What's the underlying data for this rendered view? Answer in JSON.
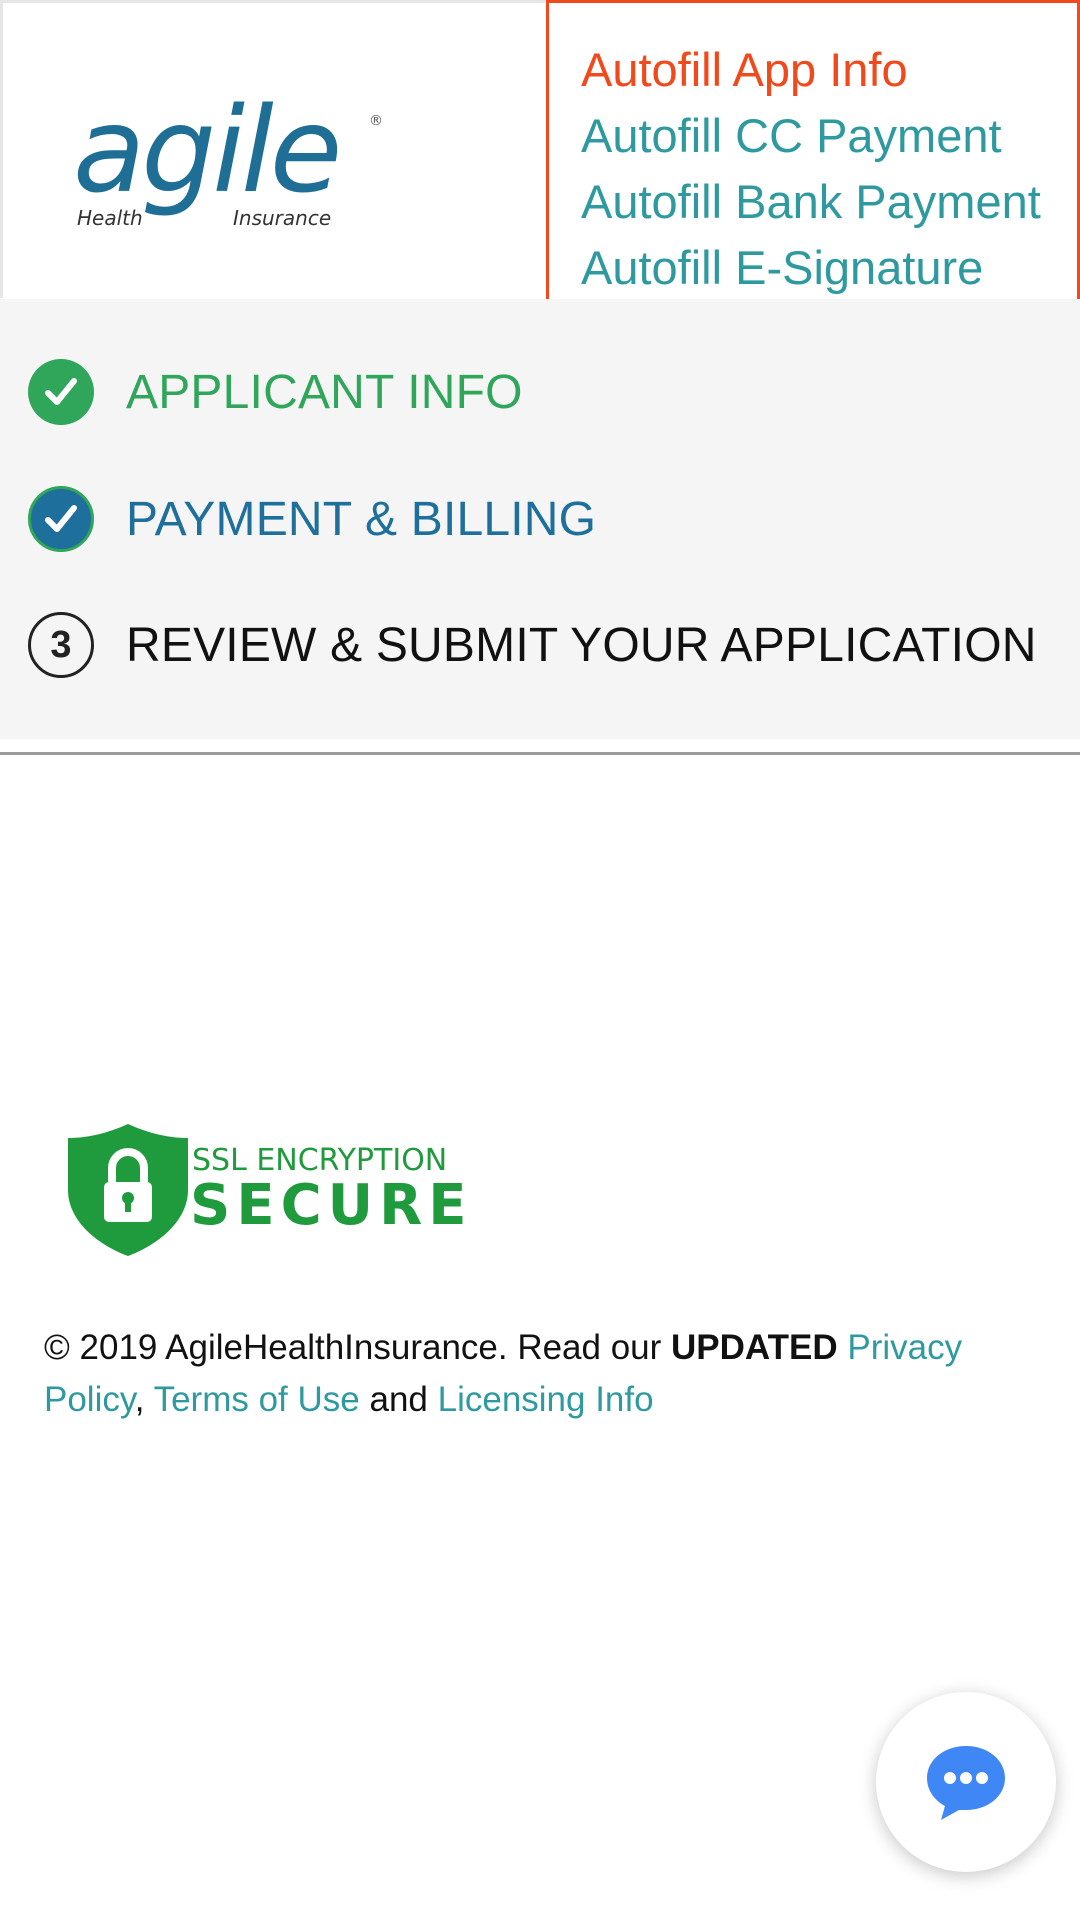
{
  "logo": {
    "wordmark": "agile",
    "sub_left": "Health",
    "sub_right": "Insurance",
    "registered": "®",
    "brand_color": "#1f6e95"
  },
  "dev_menu": {
    "items": [
      {
        "label": "Autofill App Info",
        "active": true
      },
      {
        "label": "Autofill CC Payment",
        "active": false
      },
      {
        "label": "Autofill Bank Payment",
        "active": false
      },
      {
        "label": "Autofill E-Signature",
        "active": false
      }
    ],
    "border_color": "#f04a1c"
  },
  "steps": [
    {
      "label": "APPLICANT INFO",
      "status": "complete",
      "color": "#2fa65a"
    },
    {
      "label": "PAYMENT & BILLING",
      "status": "current",
      "color": "#1e6f9c"
    },
    {
      "number": "3",
      "label": "REVIEW & SUBMIT YOUR APPLICATION",
      "status": "upcoming",
      "color": "#111111"
    }
  ],
  "ssl_badge": {
    "line1": "SSL ENCRYPTION",
    "line2": "SECURE",
    "color": "#1f9a3c"
  },
  "footer": {
    "copyright": "© 2019 AgileHealthInsurance. Read our ",
    "updated": "UPDATED",
    "privacy_policy": "Privacy Policy",
    "comma": ",",
    "terms": "Terms of Use",
    "and": " and ",
    "licensing": "Licensing Info"
  },
  "chat": {
    "icon": "chat-bubble-icon",
    "color": "#3f87f5"
  }
}
